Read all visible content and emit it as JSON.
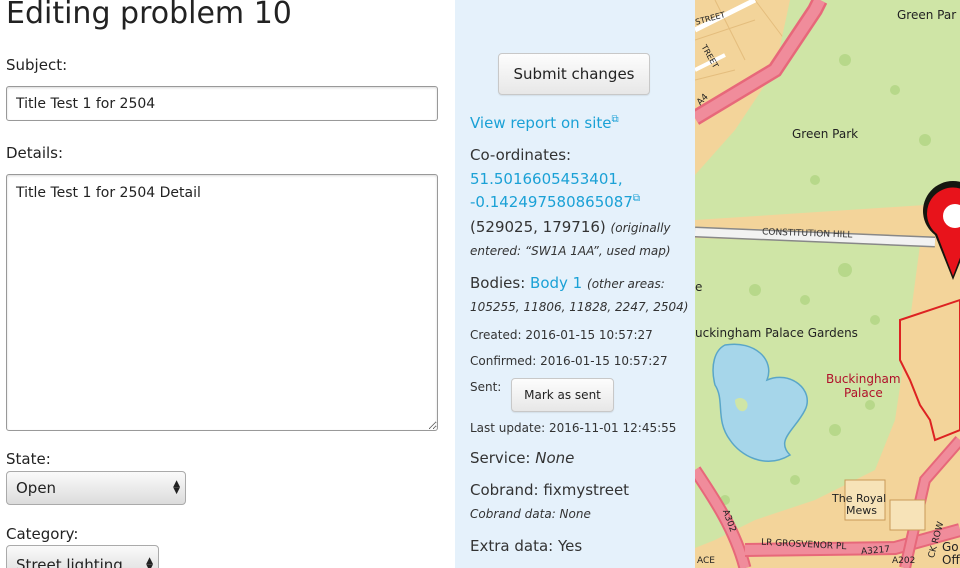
{
  "form": {
    "title": "Editing problem 10",
    "subject_label": "Subject:",
    "subject_value": "Title Test 1 for 2504",
    "details_label": "Details:",
    "details_value": "Title Test 1 for 2504 Detail",
    "state_label": "State:",
    "state_value": "Open",
    "category_label": "Category:",
    "category_value": "Street lighting"
  },
  "info": {
    "submit_label": "Submit changes",
    "view_report_link": "View report on site",
    "coords_label": "Co-ordinates:",
    "coords_lat": "51.5016605453401,",
    "coords_lon": "-0.142497580865087",
    "coords_grid": "(529025, 179716)",
    "coords_note_1": "(originally",
    "coords_note_2": "entered: “SW1A 1AA”, used map)",
    "bodies_label": "Bodies:",
    "bodies_link": "Body 1",
    "bodies_note_1": "(other areas:",
    "bodies_note_2": "105255, 11806, 11828, 2247, 2504)",
    "created": "Created: 2016-01-15 10:57:27",
    "confirmed": "Confirmed: 2016-01-15 10:57:27",
    "sent_label": "Sent:",
    "mark_sent_label": "Mark as sent",
    "last_update": "Last update: 2016-11-01 12:45:55",
    "service_label": "Service:",
    "service_value": "None",
    "cobrand_label": "Cobrand: fixmystreet",
    "cobrand_data": "Cobrand data: None",
    "extra_data": "Extra data: Yes"
  },
  "map": {
    "labels": [
      "Green Par",
      "Green Park",
      "CONSTITUTION HILL",
      "uckingham Palace Gardens",
      "Buckingham",
      "Palace",
      "The Royal",
      "Mews",
      "LR GROSVENOR PL",
      "A3217",
      "A202",
      "A302",
      "A4",
      "STREET",
      "TREET",
      "CK ROW",
      "Go",
      "Off",
      "ACE",
      "e"
    ],
    "pin_color": "#e8131b"
  },
  "colors": {
    "link": "#1ba1d6",
    "panel_bg": "#e5f1fb"
  }
}
